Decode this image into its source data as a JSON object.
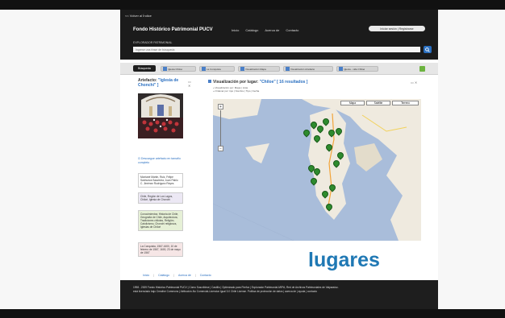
{
  "header": {
    "back_link": "<< Volver al Índice",
    "site_title": "Fondo Histórico Patrimonial PUCV",
    "nav": [
      "Inicio",
      "Catálogo",
      "Acerca de",
      "Contacto"
    ],
    "login": "Iniciar sesión | Registrarse",
    "explore_label": "EXPLORADOR PATRIMONIAL",
    "search_placeholder": "Ingrese una frase de búsqueda"
  },
  "tabs": {
    "active": "Búsqueda",
    "items": [
      "Iglesia Chiloé",
      "La Conquista",
      "Visualización Mapa",
      "Visualización Artefacto",
      "Iglesia - vida Chiloé"
    ]
  },
  "artifact": {
    "label": "Artefacto:",
    "name": "\"Iglesia de Chonchi\" ]",
    "download": "Descargue artefacto en tamaño completo",
    "cards": [
      {
        "text": "Montané Martín, Ruiz, Felipe Sanhueza Saavedra, Juan Pablo C. Jiménez Rodríguez Reyes",
        "bg": "#ffffff"
      },
      {
        "text": "Chile, Región de Los Lagos, Chiloé, Iglesia de Chonchi",
        "bg": "#ece8f4"
      },
      {
        "text": "Conocimientos: Historia de Chile, Geografía de Chile, Arquitectura, Tradiciones chilotas, Religión, Catolicismo, Chonchi religiosos, Iglesias de Chiloé",
        "bg": "#e6f0d6"
      },
      {
        "text": "La Conquista, 1567-1600, 10 de febrero de 1567, 1600, 23 de mayo de 1567",
        "bg": "#f6e6e6"
      }
    ]
  },
  "viz": {
    "title_prefix": "Visualización por lugar: ",
    "place": "\"Chiloe\"",
    "count": "[ 16 resultados ]",
    "sub1": "» Visualización por: Mapa | Lista",
    "sub2": "» Ordenar por: tipo | Nombre | Tipo | Fecha",
    "map_types": [
      "Mapa",
      "Satélite",
      "Terreno"
    ],
    "zoom_in": "+",
    "zoom_out": "−",
    "pin_count": 16
  },
  "footer_links": [
    "Inicio",
    "Catálogo",
    "Acerca de",
    "Contacto"
  ],
  "lugares": "lugares",
  "footer": {
    "line1": "1998 - 2009 Fondo Histórico Patrimonial PUCV | Cómo Suscribirse | Castillo | Optimizado para Firefox | Explorador Patrimonial ARPA, Red de Archivos Patrimoniales de Valparaíso.",
    "line2": "está licenciado bajo Creative Commons | Atribución-No Comercial-Licenciar Igual 3.0 Chile License. Política de protección de datos | acerca de | ayuda | contacto"
  },
  "colors": {
    "accent": "#2a6fc0",
    "lugares": "#1f78b4",
    "pin": "#2e8b2e",
    "water": "#a9bdda",
    "land": "#efeadf"
  }
}
